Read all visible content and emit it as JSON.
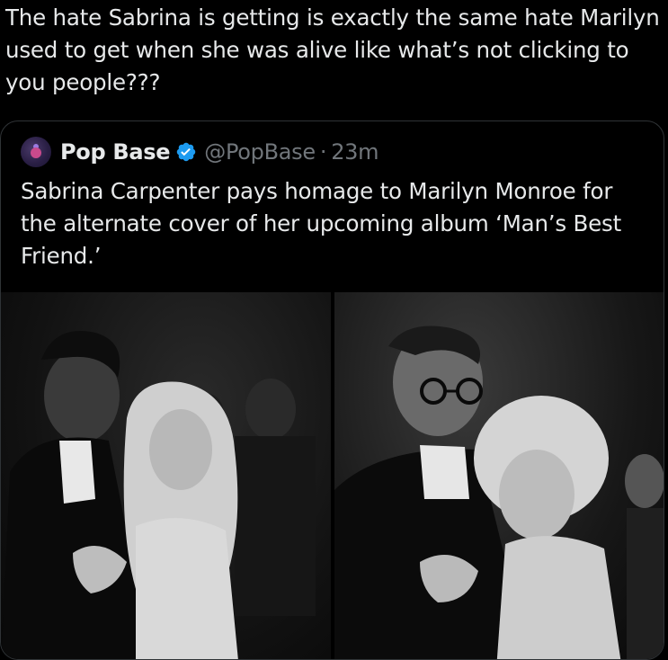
{
  "tweet": {
    "text": "The hate Sabrina is getting is exactly the same hate Marilyn used to get when she was alive like what’s not clicking to you people???"
  },
  "quote": {
    "display_name": "Pop Base",
    "handle": "@PopBase",
    "separator": "·",
    "time": "23m",
    "text": "Sabrina Carpenter pays homage to Marilyn Monroe for the alternate cover of her upcoming album ‘Man’s Best Friend.’",
    "avatar_icon": "pop-base-avatar",
    "verified_icon": "verified-badge-icon",
    "colors": {
      "verified": "#1d9bf0",
      "muted": "#71767b",
      "text": "#e7e9ea",
      "border": "#2f3336"
    },
    "media": [
      {
        "name": "black-and-white photo of Sabrina Carpenter dancing with a man"
      },
      {
        "name": "black-and-white photo of Marilyn Monroe dancing with a man in glasses"
      }
    ]
  }
}
